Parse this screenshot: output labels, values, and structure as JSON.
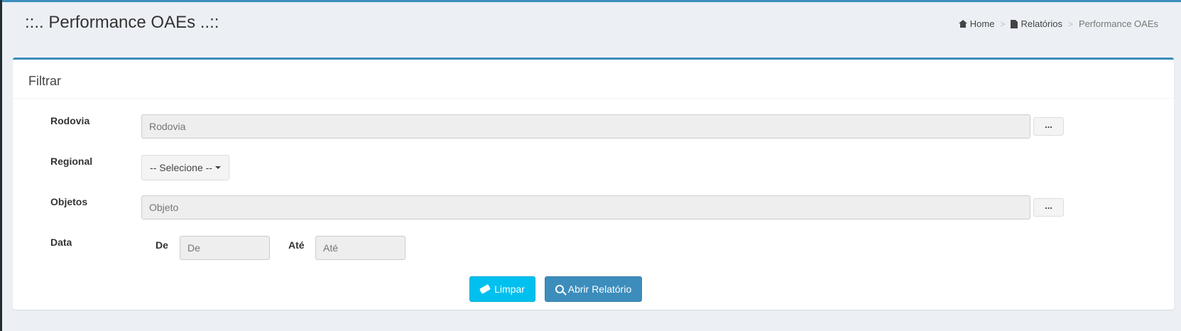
{
  "header": {
    "title": "::.. Performance OAEs ..::",
    "breadcrumb": {
      "home": "Home",
      "reports": "Relatórios",
      "current": "Performance OAEs",
      "separator": ">"
    }
  },
  "filter": {
    "title": "Filtrar",
    "rodovia": {
      "label": "Rodovia",
      "placeholder": "Rodovia",
      "lookup_label": "..."
    },
    "regional": {
      "label": "Regional",
      "selected": "-- Selecione --"
    },
    "objetos": {
      "label": "Objetos",
      "placeholder": "Objeto",
      "lookup_label": "..."
    },
    "data": {
      "label": "Data",
      "from_label": "De",
      "from_placeholder": "De",
      "to_label": "Até",
      "to_placeholder": "Até"
    }
  },
  "actions": {
    "clear_label": "Limpar",
    "open_report_label": "Abrir Relatório"
  },
  "icons": {
    "home": "home-icon",
    "reports": "file-icon",
    "clear": "eraser-icon",
    "open_report": "search-icon"
  },
  "colors": {
    "primary": "#3c8dbc",
    "info": "#00c0ef",
    "background": "#ecf0f5"
  }
}
